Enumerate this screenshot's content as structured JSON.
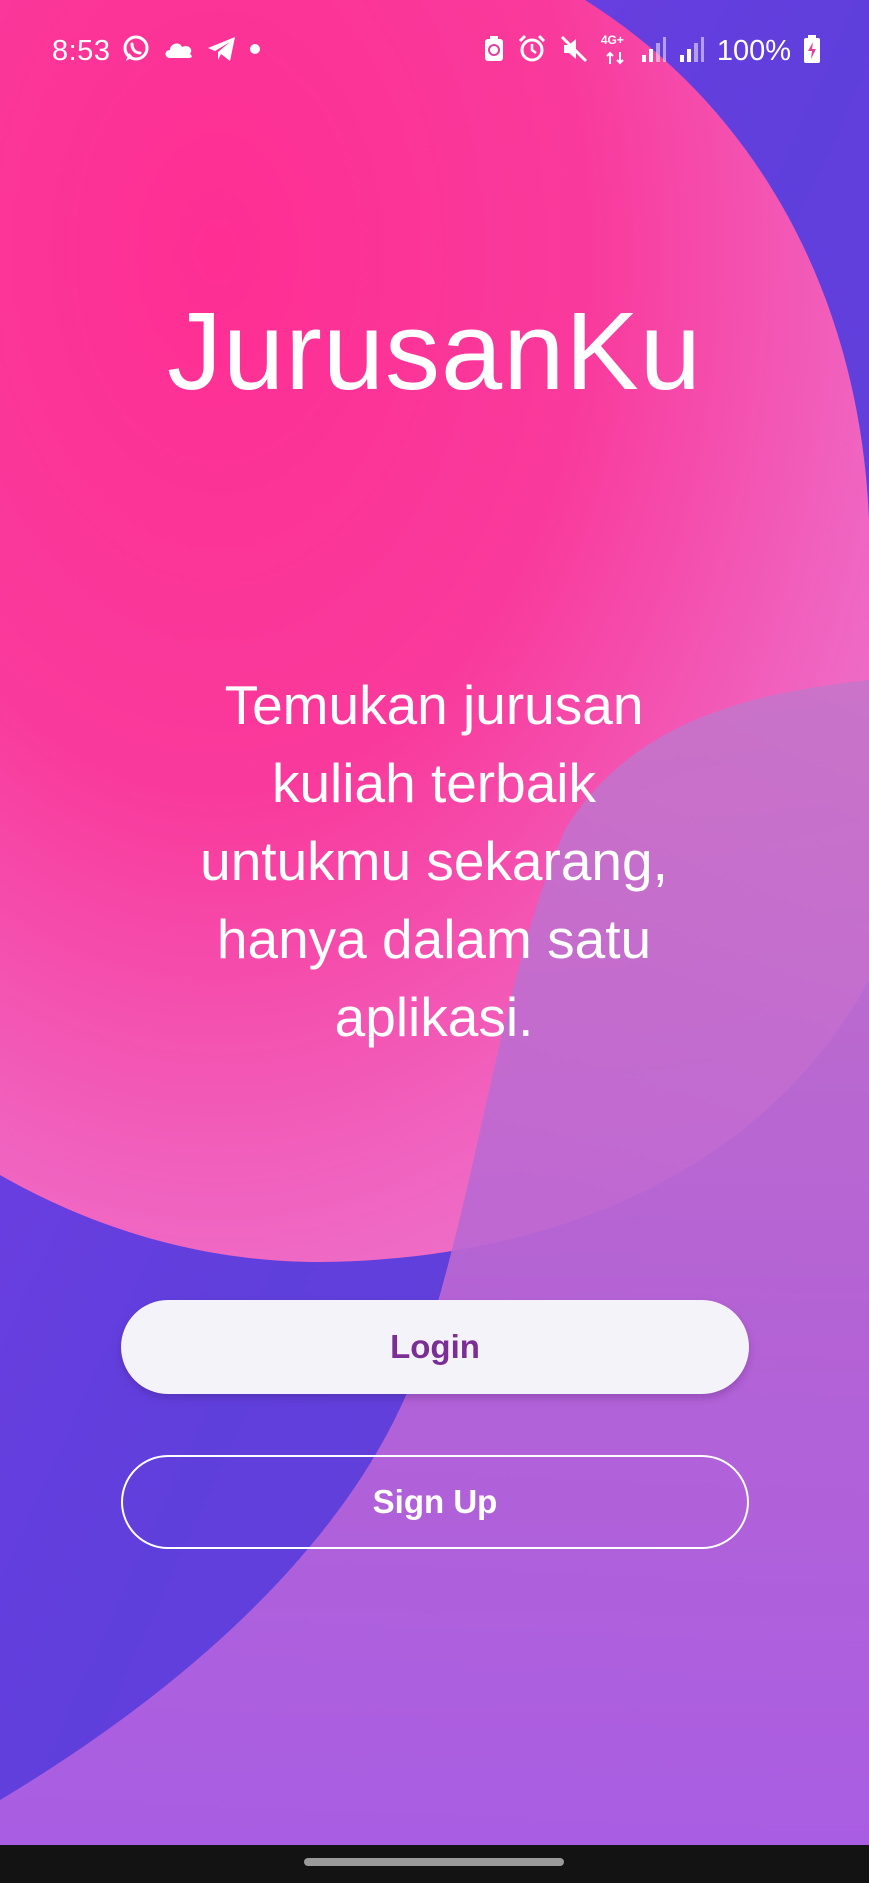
{
  "status_bar": {
    "time": "8:53",
    "left_icons": [
      "whatsapp-icon",
      "cloud-icon",
      "telegram-icon",
      "dot-icon"
    ],
    "right_icons": [
      "battery-saver-icon",
      "alarm-icon",
      "mute-icon",
      "network-4g-icon",
      "signal-icon",
      "signal-icon"
    ],
    "network_label": "4G+",
    "battery": "100%"
  },
  "main": {
    "title": "JurusanKu",
    "tagline_lines": [
      "Temukan jurusan",
      "kuliah terbaik",
      "untukmu sekarang,",
      "hanya dalam satu",
      "aplikasi."
    ]
  },
  "buttons": {
    "login_label": "Login",
    "signup_label": "Sign Up"
  },
  "colors": {
    "background_pink": "#ff2f95",
    "background_purple": "#6a3fe0",
    "background_lilac": "#b262e3",
    "button_text_purple": "#7b2f95",
    "button_fill": "#f5f3fa"
  }
}
